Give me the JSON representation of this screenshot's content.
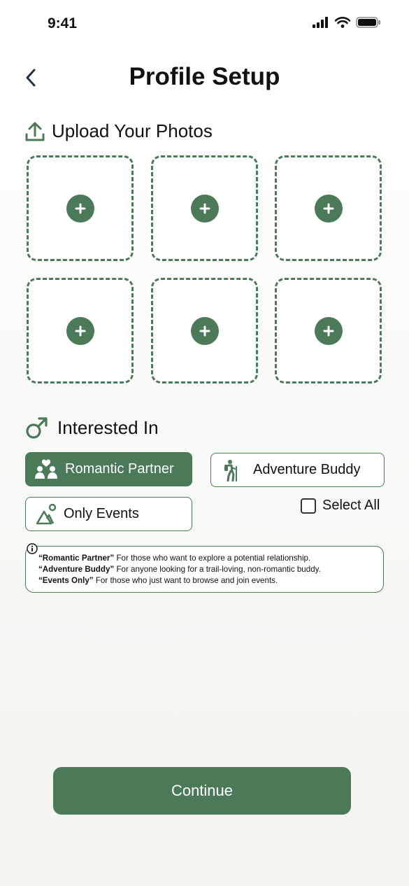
{
  "status_bar": {
    "time": "9:41"
  },
  "header": {
    "title": "Profile Setup"
  },
  "upload": {
    "title": "Upload Your Photos",
    "slot_count": 6
  },
  "interests": {
    "title": "Interested In",
    "options": [
      {
        "label": "Romantic Partner",
        "selected": true
      },
      {
        "label": "Adventure Buddy",
        "selected": false
      },
      {
        "label": "Only Events",
        "selected": false
      }
    ],
    "select_all_label": "Select All",
    "select_all_checked": false
  },
  "info": {
    "lines": [
      {
        "term": "“Romantic Partner”",
        "desc": " For those who want to explore a potential relationship."
      },
      {
        "term": "“Adventure Buddy”",
        "desc": " For anyone looking for a trail-loving, non-romantic buddy."
      },
      {
        "term": "“Events Only”",
        "desc": " For those who just want to browse and join events."
      }
    ]
  },
  "footer": {
    "continue_label": "Continue"
  },
  "colors": {
    "accent": "#4a7a57",
    "text": "#111111",
    "background": "#f3f4ef"
  }
}
